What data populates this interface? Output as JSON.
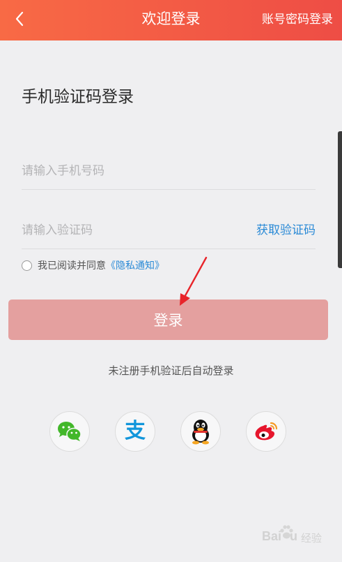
{
  "header": {
    "title": "欢迎登录",
    "alt_login_label": "账号密码登录",
    "back_icon": "chevron-left-icon"
  },
  "colors": {
    "header_start": "#f86a45",
    "header_end": "#ee4d45",
    "login_button": "#e4a09f",
    "link_blue": "#2a8ad6",
    "annotation_red": "#e8242a"
  },
  "form": {
    "heading": "手机验证码登录",
    "phone_placeholder": "请输入手机号码",
    "code_placeholder": "请输入验证码",
    "get_code_label": "获取验证码"
  },
  "agreement": {
    "text": "我已阅读并同意",
    "link": "《隐私通知》"
  },
  "login_button_label": "登录",
  "hint": "未注册手机验证后自动登录",
  "social_logins": [
    {
      "name": "wechat",
      "icon": "wechat-icon"
    },
    {
      "name": "alipay",
      "icon": "alipay-icon",
      "glyph": "支"
    },
    {
      "name": "qq",
      "icon": "qq-icon"
    },
    {
      "name": "weibo",
      "icon": "weibo-icon"
    }
  ],
  "watermark": {
    "brand": "Bai",
    "brand_end": "u",
    "cn": "经验"
  }
}
